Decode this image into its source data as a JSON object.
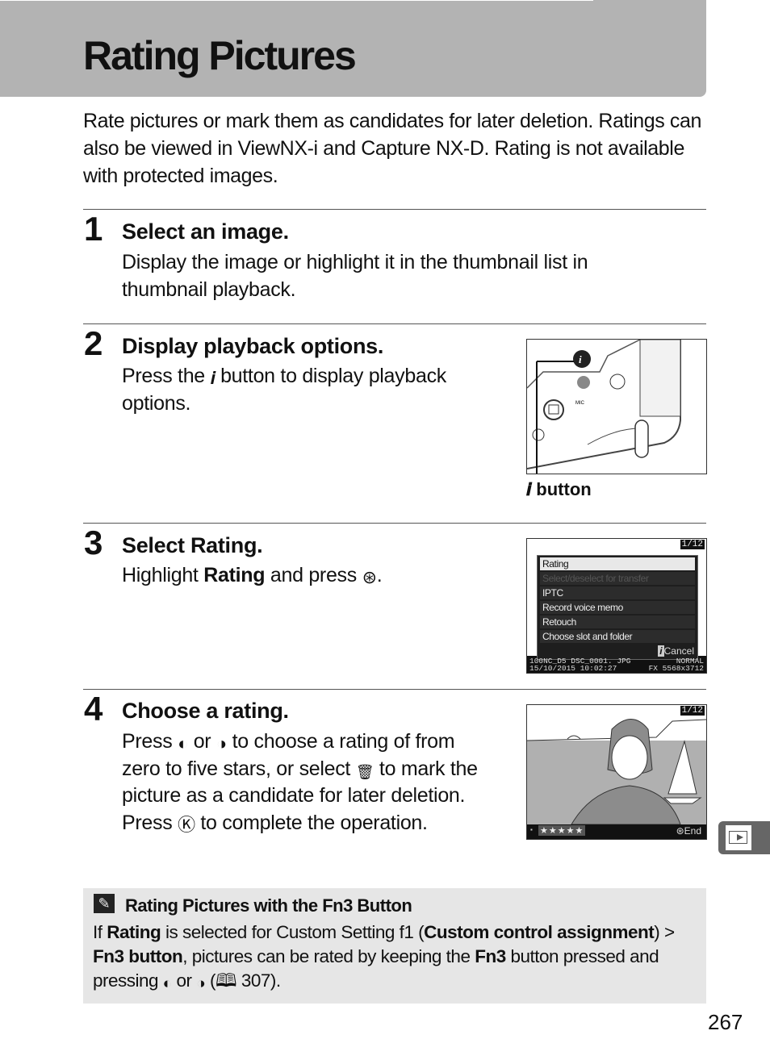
{
  "header": {
    "title": "Rating Pictures"
  },
  "intro": "Rate pictures or mark them as candidates for later deletion. Ratings can also be viewed in ViewNX-i and Capture NX-D.  Rating is not available with protected images.",
  "steps": [
    {
      "number": "1",
      "title": "Select an image.",
      "body": "Display the image or highlight it in the thumbnail list in thumbnail playback."
    },
    {
      "number": "2",
      "title": "Display playback options.",
      "body_pre": "Press the ",
      "body_icon": "𝒊",
      "body_post": " button to display playback options.",
      "figure_caption_icon": "𝒊",
      "figure_caption": " button"
    },
    {
      "number": "3",
      "title_pre": "Select ",
      "title_bold": "Rating",
      "title_post": ".",
      "body_pre": "Highlight ",
      "body_bold": "Rating",
      "body_mid": " and press ",
      "body_icon": "⊛",
      "body_post": "."
    },
    {
      "number": "4",
      "title": "Choose a rating.",
      "body_l1a": "Press ",
      "icon_left": "◐",
      "body_l1b": " or ",
      "icon_right": "◑",
      "body_l1c": " to choose a rating of from",
      "body_l2a": "zero to five stars, or select ",
      "icon_trash": "🗑",
      "body_l2b": " to mark the",
      "body_l3": "picture as a candidate for later deletion.",
      "body_l4a": "Press ",
      "icon_ok": "Ⓚ",
      "body_l4b": " to complete the operation."
    }
  ],
  "lcd_menu": {
    "counter": "1/12",
    "items": [
      "Rating",
      "Select/deselect for transfer",
      "IPTC",
      "Record voice memo",
      "Retouch",
      "Choose slot and folder"
    ],
    "selected_index": 0,
    "disabled_index": 1,
    "cancel_icon": "i",
    "cancel": "Cancel",
    "info_l1_left": "100NC_D5  DSC_0001. JPG",
    "info_l1_right": "NORMAL",
    "info_l2_left": "15/10/2015  10:02:27",
    "info_l2_right": "FX  5568x3712"
  },
  "lcd_rating": {
    "counter": "1/12",
    "stars": "★★★★★",
    "rating_stars": 5,
    "end_icon": "⊛",
    "end": "End"
  },
  "tip": {
    "icon": "✎",
    "title": "Rating Pictures with the Fn3 Button",
    "b1": "If ",
    "b2": "Rating",
    "b3": " is selected for Custom Setting f1 (",
    "b4": "Custom control assignment",
    "b5": ") > ",
    "b6": "Fn3 button",
    "b7": ", pictures can be rated by keeping the ",
    "b8": "Fn3",
    "b9": " button pressed and pressing ",
    "b10": "◐",
    "b11": " or ",
    "b12": "◑",
    "b13": " (",
    "b14": "🕮",
    "b15": " 307)."
  },
  "side_tab": {
    "icon": "playback-icon"
  },
  "page_number": "267"
}
